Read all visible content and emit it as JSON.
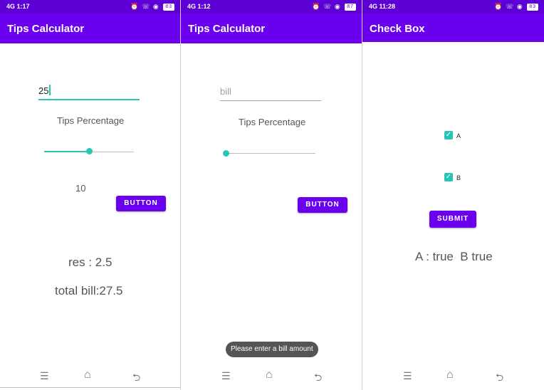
{
  "screens": [
    {
      "status": {
        "time": "1:17",
        "signal": "4G",
        "battery": "83"
      },
      "title": "Tips Calculator",
      "bill_input": {
        "value": "25",
        "placeholder": "bill"
      },
      "tips_label": "Tips Percentage",
      "slider": {
        "fraction": 0.5
      },
      "slider_value": "10",
      "button_label": "BUTTON",
      "res_text": "res : 2.5",
      "total_text": "total bill:27.5"
    },
    {
      "status": {
        "time": "1:12",
        "signal": "4G",
        "battery": "87"
      },
      "title": "Tips Calculator",
      "bill_input": {
        "value": "",
        "placeholder": "bill"
      },
      "tips_label": "Tips Percentage",
      "slider": {
        "fraction": 0.0
      },
      "button_label": "BUTTON",
      "toast": "Please enter a bill amount"
    },
    {
      "status": {
        "time": "11:28",
        "signal": "4G",
        "battery": "83"
      },
      "title": "Check Box",
      "checkboxes": [
        {
          "label": "A",
          "checked": true
        },
        {
          "label": "B",
          "checked": true
        }
      ],
      "submit_label": "SUBMIT",
      "result_text": "A : true  B true"
    }
  ],
  "icons": {
    "menu": "☰",
    "home": "⌂",
    "back": "⮌",
    "check": "✓",
    "status_icons": "⏰ ☏ ◉"
  },
  "colors": {
    "primary": "#6a00ee",
    "status_bar": "#5c00d6",
    "accent": "#26c6b4"
  }
}
